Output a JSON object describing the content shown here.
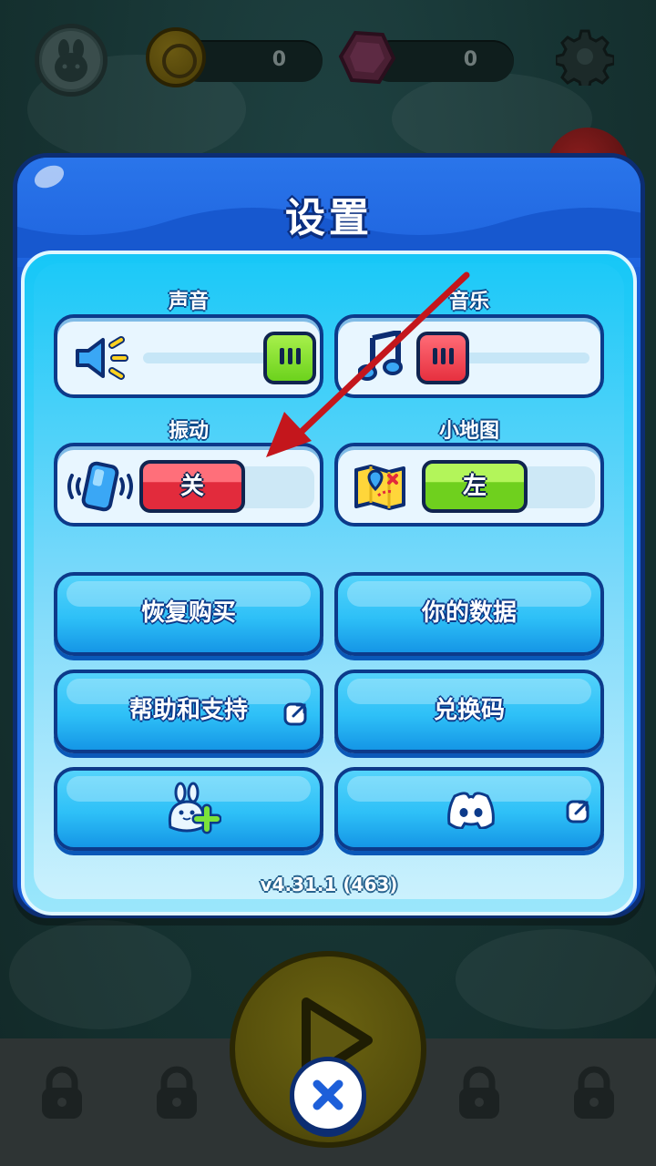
{
  "hud": {
    "coins": "0",
    "gems": "0"
  },
  "dialog": {
    "title": "设置",
    "version": "v4.31.1 (463)"
  },
  "settings": {
    "sound": {
      "label": "声音",
      "level": 1.0
    },
    "music": {
      "label": "音乐",
      "level": 0.0
    },
    "vibration": {
      "label": "振动",
      "value": "关"
    },
    "minimap": {
      "label": "小地图",
      "value": "左"
    }
  },
  "buttons": {
    "restore_purchase": "恢复购买",
    "your_data": "你的数据",
    "help_support": "帮助和支持",
    "redeem_code": "兑换码"
  },
  "icons": {
    "avatar": "bunny-icon",
    "coin": "coin-icon",
    "gem": "gem-icon",
    "settings": "gear-icon",
    "sound": "speaker-icon",
    "music": "music-note-icon",
    "vibration": "vibrate-phone-icon",
    "minimap": "map-icon",
    "add_friend": "add-friend-icon",
    "discord": "discord-icon",
    "external": "external-link-icon",
    "close": "close-icon",
    "play": "play-icon",
    "lock": "lock-icon"
  },
  "colors": {
    "dialog_blue": "#1b5fd9",
    "panel_cyan": "#16c7f7",
    "toggle_off_red": "#e22b3c",
    "toggle_on_green": "#6fd01e",
    "annotation_arrow": "#c4161c"
  }
}
